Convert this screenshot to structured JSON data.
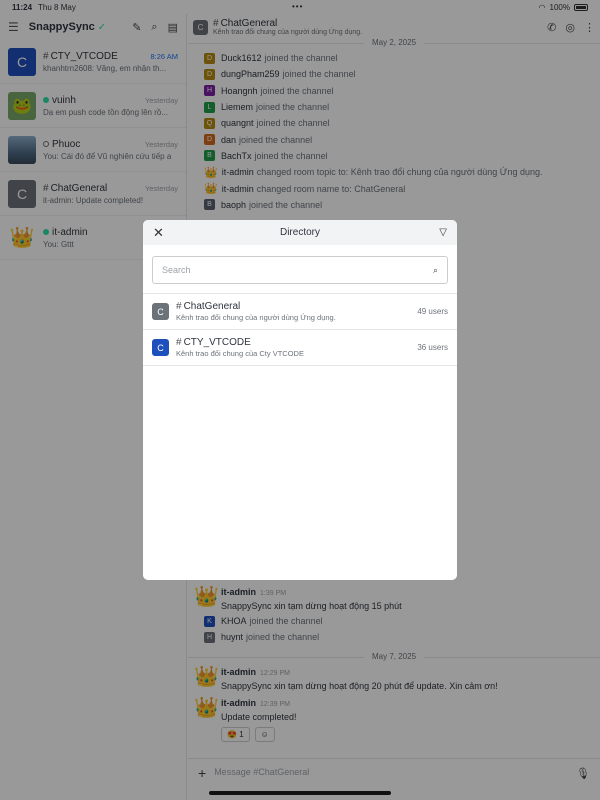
{
  "status_bar": {
    "time": "11:24",
    "date": "Thu 8 May",
    "dots": "•••",
    "battery": "100%"
  },
  "sidebar": {
    "title": "SnappySync",
    "rooms": [
      {
        "avatar_letter": "C",
        "avatar_color": "#1d4fbd",
        "name": "CTY_VTCODE",
        "kind": "channel",
        "time": "8:26 AM",
        "preview": "khanhtrn2608: Vâng, em nhận th..."
      },
      {
        "avatar_letter": "",
        "avatar_color": "#7aa86a",
        "name": "vuinh",
        "kind": "dm-online",
        "time": "Yesterday",
        "preview": "Dạ em push code tồn động lên rồ..."
      },
      {
        "avatar_letter": "",
        "avatar_color": "#5b7a99",
        "name": "Phuoc",
        "kind": "dm-offline",
        "time": "Yesterday",
        "preview": "You: Cái đó để Vũ nghiên cứu tiếp a"
      },
      {
        "avatar_letter": "C",
        "avatar_color": "#6c727a",
        "name": "ChatGeneral",
        "kind": "channel",
        "time": "Yesterday",
        "preview": "it-admin: Update completed!"
      },
      {
        "avatar_letter": "",
        "avatar_color": "#e8b5b5",
        "name": "it-admin",
        "kind": "dm-online",
        "time": "",
        "preview": "You: Gttt"
      }
    ]
  },
  "main": {
    "room_name": "ChatGeneral",
    "room_topic": "Kênh trao đổi chung của người dùng Ứng dụng.",
    "date1": "May 2, 2025",
    "system_messages": [
      {
        "avatar": "D",
        "color": "#b58a0f",
        "user": "Duck1612",
        "text": "joined the channel"
      },
      {
        "avatar": "D",
        "color": "#b58a0f",
        "user": "dungPham259",
        "text": "joined the channel"
      },
      {
        "avatar": "H",
        "color": "#7c1fa3",
        "user": "Hoangnh",
        "text": "joined the channel"
      },
      {
        "avatar": "L",
        "color": "#1f9e4a",
        "user": "Liemem",
        "text": "joined the channel"
      },
      {
        "avatar": "Q",
        "color": "#b58a0f",
        "user": "quangnt",
        "text": "joined the channel"
      },
      {
        "avatar": "D",
        "color": "#d26a1b",
        "user": "dan",
        "text": "joined the channel"
      },
      {
        "avatar": "B",
        "color": "#1f9e4a",
        "user": "BachTx",
        "text": "joined the channel"
      },
      {
        "avatar": "crown",
        "color": "",
        "user": "it-admin",
        "text": "changed room topic to: Kênh trao đổi chung của người dùng Ứng dụng."
      },
      {
        "avatar": "crown",
        "color": "",
        "user": "it-admin",
        "text": "changed room name to: ChatGeneral"
      },
      {
        "avatar": "B",
        "color": "#5b6270",
        "user": "baoph",
        "text": "joined the channel"
      }
    ],
    "later_msg": {
      "user": "it-admin",
      "time": "1:39 PM",
      "text": "SnappySync xin tạm dừng hoạt động 15 phút"
    },
    "later_sys": [
      {
        "avatar": "K",
        "color": "#1d4fbd",
        "user": "KHOA",
        "text": "joined the channel"
      },
      {
        "avatar": "H",
        "color": "#6c727a",
        "user": "huynt",
        "text": "joined the channel"
      }
    ],
    "date2": "May 7, 2025",
    "msgs2": [
      {
        "user": "it-admin",
        "time": "12:29 PM",
        "text": "SnappySync xin tạm dừng hoạt động 20 phút để update. Xin cảm ơn!"
      },
      {
        "user": "it-admin",
        "time": "12:39 PM",
        "text": "Update completed!"
      }
    ],
    "reaction_count": "1",
    "composer_placeholder": "Message #ChatGeneral"
  },
  "modal": {
    "title": "Directory",
    "search_placeholder": "Search",
    "rows": [
      {
        "avatar_letter": "C",
        "avatar_color": "#6c727a",
        "name": "ChatGeneral",
        "desc": "Kênh trao đổi chung của người dùng Ứng dụng.",
        "users": "49 users"
      },
      {
        "avatar_letter": "C",
        "avatar_color": "#1d4fbd",
        "name": "CTY_VTCODE",
        "desc": "Kênh trao đổi chung của Cty VTCODE",
        "users": "36 users"
      }
    ]
  }
}
